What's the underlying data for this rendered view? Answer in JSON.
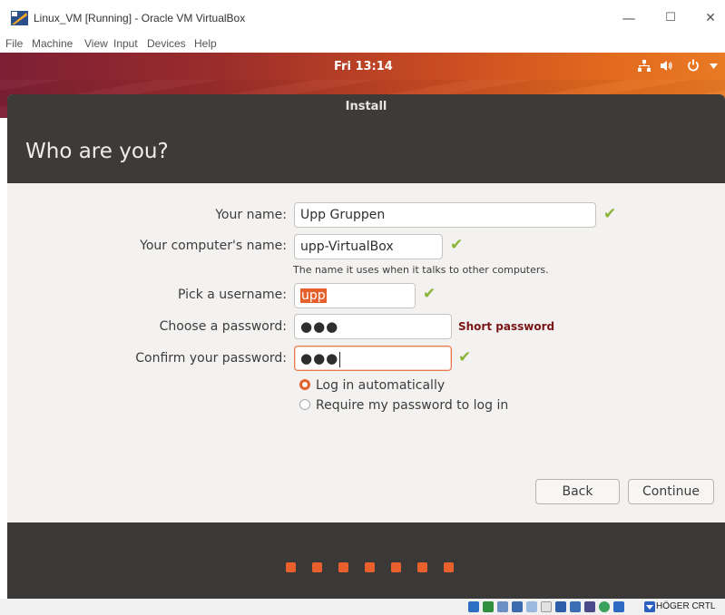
{
  "window": {
    "title": "Linux_VM [Running] - Oracle VM VirtualBox",
    "minimize": "—",
    "maximize": "☐",
    "close": "✕"
  },
  "menu": [
    "File",
    "Machine",
    "View",
    "Input",
    "Devices",
    "Help"
  ],
  "panel": {
    "clock": "Fri 13:14",
    "network_icon": "network-icon",
    "volume_icon": "volume-icon",
    "power_icon": "power-icon"
  },
  "installer": {
    "title": "Install",
    "heading": "Who are you?",
    "labels": {
      "name": "Your name:",
      "computer": "Your computer's name:",
      "username": "Pick a username:",
      "password": "Choose a password:",
      "confirm": "Confirm your password:"
    },
    "values": {
      "name": "Upp Gruppen",
      "computer": "upp-VirtualBox",
      "username": "upp",
      "password": "●●●",
      "confirm": "●●●"
    },
    "computer_hint": "The name it uses when it talks to other computers.",
    "password_strength": "Short password",
    "login_options": [
      "Log in automatically",
      "Require my password to log in"
    ],
    "selected_login": 0,
    "buttons": {
      "back": "Back",
      "continue": "Continue"
    },
    "step_count": 7,
    "accent": "#e9602d"
  },
  "statusbar": {
    "host_key": "HÖGER CRTL"
  }
}
